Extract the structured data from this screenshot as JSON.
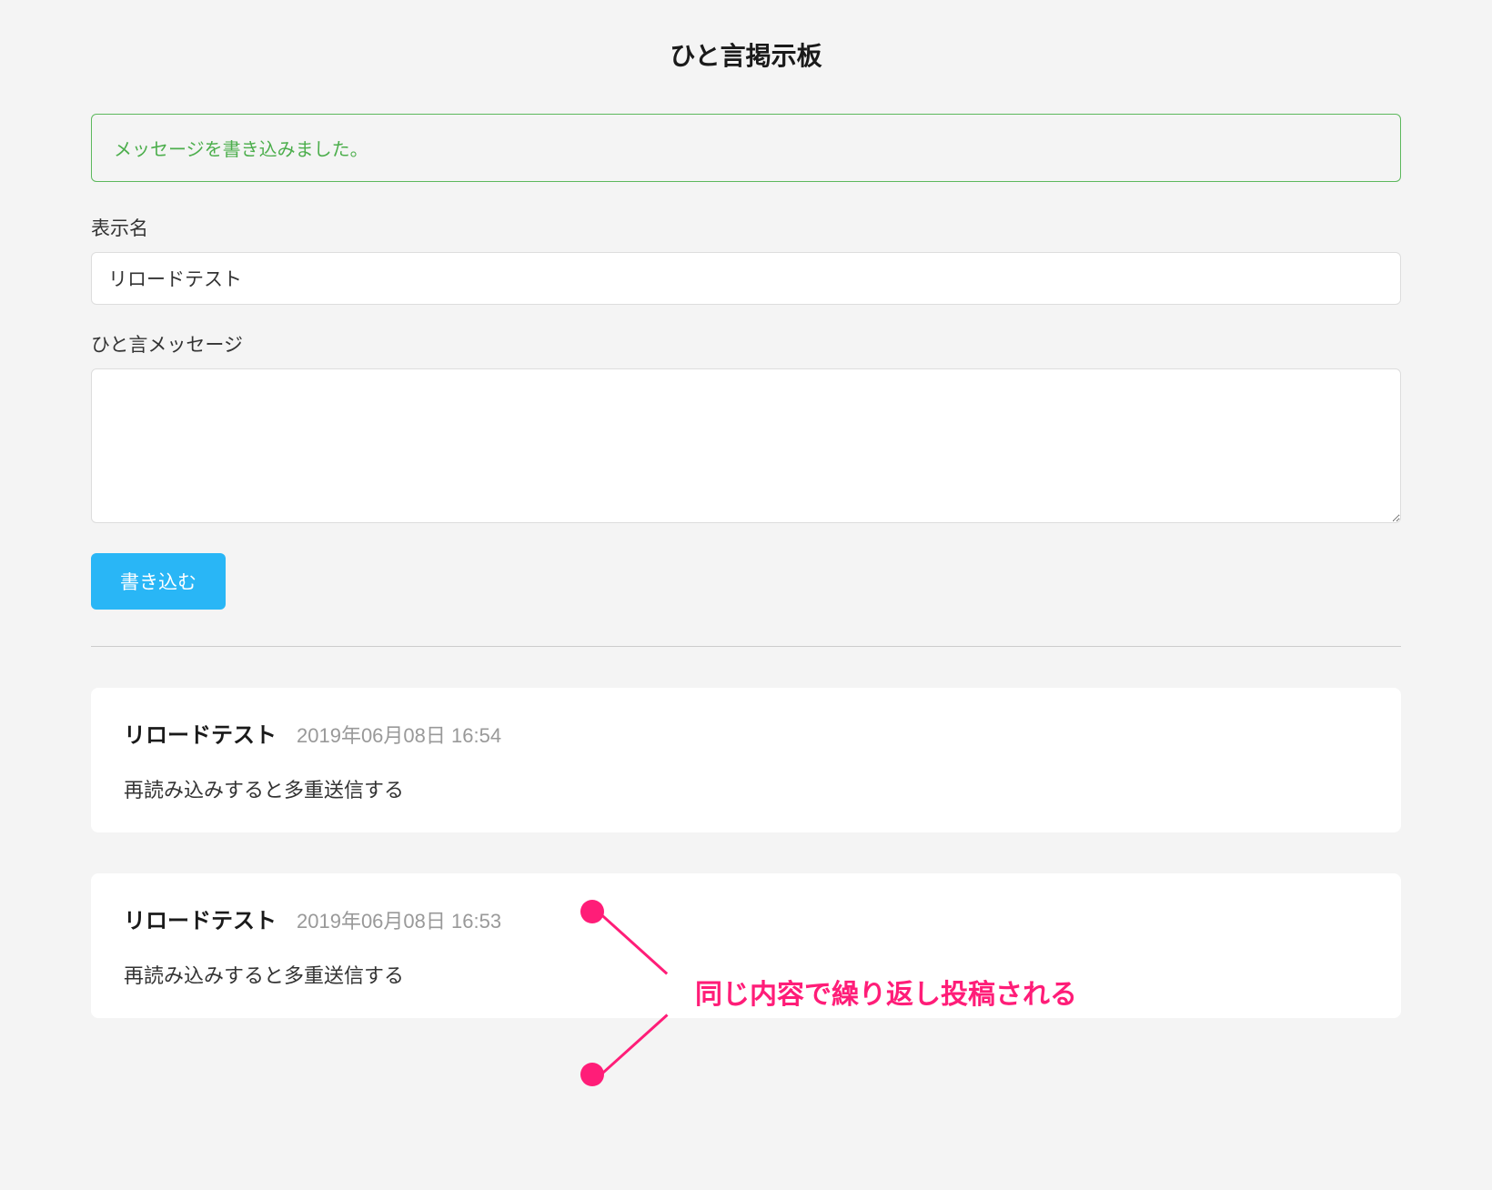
{
  "page": {
    "title": "ひと言掲示板"
  },
  "alert": {
    "message": "メッセージを書き込みました。"
  },
  "form": {
    "name_label": "表示名",
    "name_value": "リロードテスト",
    "message_label": "ひと言メッセージ",
    "message_value": "",
    "submit_label": "書き込む"
  },
  "posts": [
    {
      "author": "リロードテスト",
      "timestamp": "2019年06月08日 16:54",
      "body": "再読み込みすると多重送信する"
    },
    {
      "author": "リロードテスト",
      "timestamp": "2019年06月08日 16:53",
      "body": "再読み込みすると多重送信する"
    }
  ],
  "annotation": {
    "text": "同じ内容で繰り返し投稿される"
  }
}
